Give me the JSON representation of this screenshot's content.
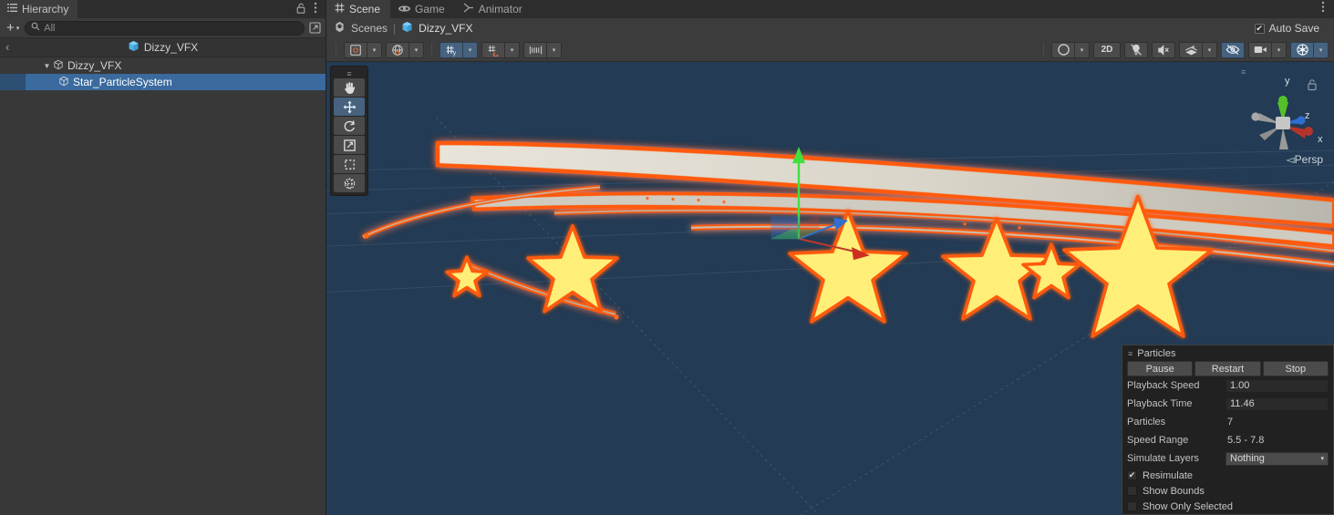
{
  "hierarchy": {
    "tab_label": "Hierarchy",
    "tab_lock_icon": "lock-icon",
    "tab_menu_icon": "kebab-menu-icon",
    "create_label": "+",
    "create_caret": "▾",
    "search_placeholder": "All",
    "search_value": "",
    "search_icon": "search-icon",
    "expand_icon": "expand-window-icon",
    "breadcrumb_back": "‹",
    "breadcrumb_label": "Dizzy_VFX",
    "rows": [
      {
        "label": "Dizzy_VFX",
        "depth": 1,
        "expanded": true,
        "selected": false,
        "triangle": "▼"
      },
      {
        "label": "Star_ParticleSystem",
        "depth": 2,
        "expanded": false,
        "selected": true,
        "triangle": ""
      }
    ]
  },
  "scene": {
    "tabs": [
      {
        "label": "Scene",
        "icon": "grid-icon",
        "active": true
      },
      {
        "label": "Game",
        "icon": "gamepad-icon",
        "active": false
      },
      {
        "label": "Animator",
        "icon": "animator-icon",
        "active": false
      }
    ],
    "menu_icon": "kebab-menu-icon",
    "breadcrumb": {
      "scenes_label": "Scenes",
      "scenes_icon": "unity-icon",
      "separator": "|",
      "current_label": "Dizzy_VFX",
      "current_icon": "prefab-cube-icon"
    },
    "autosave": {
      "label": "Auto Save",
      "checked": true,
      "check_glyph": "✔"
    },
    "toolbar_left": [
      {
        "name": "pivot-toggle",
        "icon": "pivot-icon",
        "caret": "▾",
        "active": false
      },
      {
        "name": "handle-space-toggle",
        "icon": "globe-icon",
        "caret": "▾",
        "active": false
      },
      {
        "name": "grid-snapping-toggle",
        "icon": "grid-snap-icon",
        "caret": "▾",
        "active": true
      },
      {
        "name": "grid-visibility-toggle",
        "icon": "grid-magnet-icon",
        "caret": "▾",
        "active": false
      },
      {
        "name": "snap-increment",
        "icon": "ruler-icon",
        "caret": "▾",
        "active": false
      }
    ],
    "toolbar_right": [
      {
        "name": "shading-mode",
        "label": "",
        "icon": "shaded-sphere-icon",
        "caret": "▾",
        "active": false
      },
      {
        "name": "2d-toggle",
        "label": "2D",
        "icon": "",
        "caret": "",
        "active": false
      },
      {
        "name": "scene-lighting-toggle",
        "label": "",
        "icon": "light-off-icon",
        "caret": "",
        "active": false
      },
      {
        "name": "audio-toggle",
        "label": "",
        "icon": "audio-off-icon",
        "caret": "",
        "active": false
      },
      {
        "name": "effects-toggle",
        "label": "",
        "icon": "fx-icon",
        "caret": "▾",
        "active": false
      },
      {
        "name": "hidden-objects-toggle",
        "label": "",
        "icon": "eye-off-icon",
        "caret": "",
        "active": true
      },
      {
        "name": "camera-settings",
        "label": "",
        "icon": "camera-icon",
        "caret": "▾",
        "active": false
      },
      {
        "name": "gizmos-toggle",
        "label": "",
        "icon": "gizmos-icon",
        "caret": "▾",
        "active": true
      }
    ],
    "tool_palette": {
      "grip": "≡",
      "tools": [
        {
          "name": "hand-tool",
          "icon": "hand-icon",
          "active": false
        },
        {
          "name": "move-tool",
          "icon": "move-icon",
          "active": true
        },
        {
          "name": "rotate-tool",
          "icon": "rotate-icon",
          "active": false
        },
        {
          "name": "scale-tool",
          "icon": "scale-icon",
          "active": false
        },
        {
          "name": "rect-tool",
          "icon": "rect-transform-icon",
          "active": false
        },
        {
          "name": "transform-tool",
          "icon": "transform-icon",
          "active": false
        }
      ]
    },
    "gizmo": {
      "x_label": "x",
      "y_label": "y",
      "z_label": "z",
      "persp_label": "Persp",
      "persp_prefix": "◅",
      "lock_icon": "lock-icon",
      "grip": "≡",
      "x_color": "#b5342a",
      "y_color": "#55c12a",
      "z_color": "#2f6fd0"
    },
    "viewport": {
      "background_color": "#233b54",
      "star_fill": "#ffef78",
      "star_stroke": "#ff5a0a",
      "trail_core": "#d8d5cc",
      "grid_color": "#3c5166",
      "axis_x_color": "#c0392b",
      "axis_y_color": "#3fe03f",
      "axis_z_color": "#2f6fd0"
    }
  },
  "particles_panel": {
    "title": "Particles",
    "grip": "≡",
    "buttons": [
      {
        "name": "pause-button",
        "label": "Pause"
      },
      {
        "name": "restart-button",
        "label": "Restart"
      },
      {
        "name": "stop-button",
        "label": "Stop"
      }
    ],
    "fields": [
      {
        "name": "playback-speed",
        "label": "Playback Speed",
        "value": "1.00",
        "kind": "field"
      },
      {
        "name": "playback-time",
        "label": "Playback Time",
        "value": "11.46",
        "kind": "field"
      },
      {
        "name": "particles-count",
        "label": "Particles",
        "value": "7",
        "kind": "text"
      },
      {
        "name": "speed-range",
        "label": "Speed Range",
        "value": "5.5 - 7.8",
        "kind": "text"
      },
      {
        "name": "simulate-layers",
        "label": "Simulate Layers",
        "value": "Nothing",
        "kind": "dropdown",
        "caret": "▾"
      }
    ],
    "checkboxes": [
      {
        "name": "resimulate-checkbox",
        "label": "Resimulate",
        "checked": true
      },
      {
        "name": "show-bounds-checkbox",
        "label": "Show Bounds",
        "checked": false
      },
      {
        "name": "show-only-selected-checkbox",
        "label": "Show Only Selected",
        "checked": false
      }
    ],
    "check_glyph": "✔"
  }
}
